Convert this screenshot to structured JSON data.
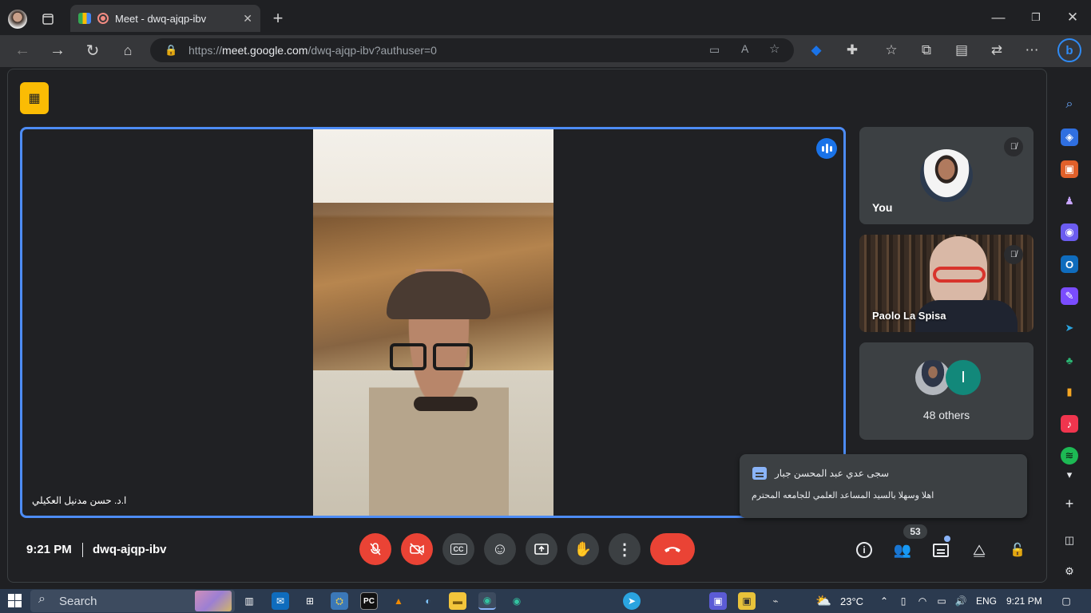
{
  "browser": {
    "tab_title": "Meet - dwq-ajqp-ibv",
    "url_scheme": "https://",
    "url_host": "meet.google.com",
    "url_path": "/dwq-ajqp-ibv?authuser=0",
    "window_controls": [
      "minimize-icon",
      "restore-icon",
      "close-icon"
    ]
  },
  "meeting": {
    "main_speaker_name": "ا.د. حسن مدنيل العكيلي",
    "time": "9:21 PM",
    "code": "dwq-ajqp-ibv",
    "participants_count": "53"
  },
  "tiles": {
    "you_label": "You",
    "paolo_label": "Paolo La Spisa",
    "others_initial": "I",
    "others_label": "48 others"
  },
  "chat_popup": {
    "sender": "سجى عدي عبد المحسن جبار",
    "message": "اهلا وسهلا بالسيد المساعد العلمي للجامعه المحترم"
  },
  "taskbar": {
    "search_placeholder": "Search",
    "weather": "23°C",
    "language": "ENG",
    "clock": "9:21 PM"
  },
  "colors": {
    "accent_blue": "#4d8cf5",
    "danger_red": "#ea4335",
    "meet_bg": "#202124",
    "tile_bg": "#3c4043",
    "yellow_badge": "#fbbc04",
    "teal_avatar": "#12887a"
  }
}
